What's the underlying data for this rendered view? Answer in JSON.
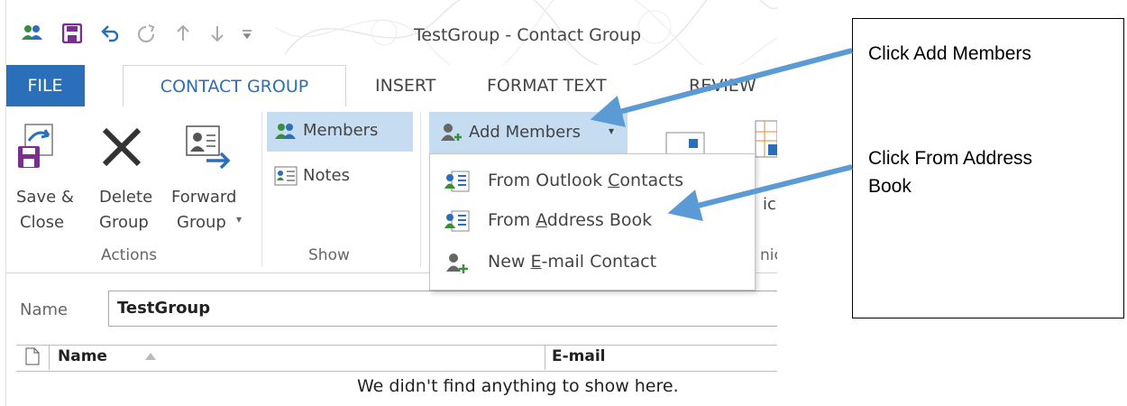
{
  "window": {
    "title": "TestGroup - Contact Group",
    "quick_access": [
      "people-icon",
      "save-icon",
      "undo-icon",
      "redo-icon",
      "up-arrow-icon",
      "down-arrow-icon",
      "customize-qat-icon"
    ]
  },
  "tabs": {
    "file": "FILE",
    "contact_group": "CONTACT GROUP",
    "insert": "INSERT",
    "format_text": "FORMAT TEXT",
    "review": "REVIEW"
  },
  "ribbon": {
    "actions": {
      "save_close_line1": "Save &",
      "save_close_line2": "Close",
      "delete_line1": "Delete",
      "delete_line2": "Group",
      "forward_line1": "Forward",
      "forward_line2": "Group",
      "group_label": "Actions"
    },
    "show": {
      "members": "Members",
      "notes": "Notes",
      "group_label": "Show"
    },
    "add_members": "Add Members",
    "partial_text_1": "ice",
    "partial_group_label": "nic"
  },
  "dropdown": {
    "items": [
      {
        "label": "From Outlook Contacts",
        "accel": "C",
        "icon": "address-book-icon"
      },
      {
        "label": "From Address Book",
        "accel": "A",
        "icon": "address-book-icon"
      },
      {
        "label": "New E-mail Contact",
        "accel": "E",
        "icon": "new-contact-icon"
      }
    ]
  },
  "form": {
    "name_label": "Name",
    "name_value": "TestGroup"
  },
  "list": {
    "columns": [
      "Name",
      "E-mail"
    ],
    "empty_message": "We didn't find anything to show here."
  },
  "annotation": {
    "line1": "Click Add Members",
    "line2a": "Click From Address",
    "line2b": "Book",
    "arrow_color": "#5b9bd5"
  }
}
